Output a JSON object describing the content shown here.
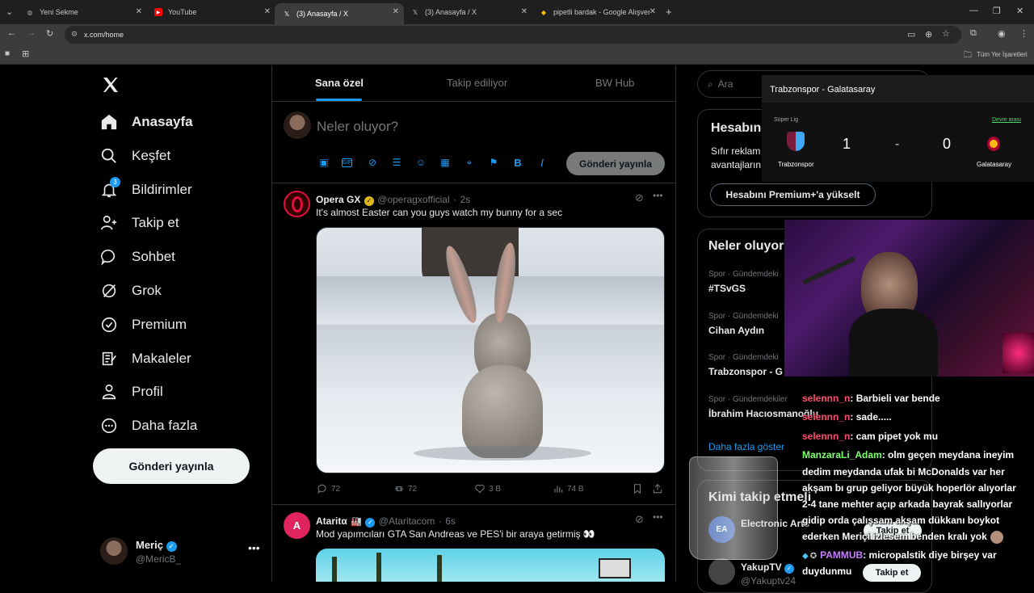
{
  "browser": {
    "tabs": [
      {
        "title": "Yeni Sekme",
        "icon": "globe-icon"
      },
      {
        "title": "YouTube",
        "icon": "youtube-icon"
      },
      {
        "title": "(3) Anasayfa / X",
        "icon": "x-icon"
      },
      {
        "title": "(3) Anasayfa / X",
        "icon": "x-icon"
      },
      {
        "title": "pipetli bardak - Google Alışveri",
        "icon": "google-icon"
      }
    ],
    "url": "x.com/home",
    "bookmarks_all": "Tüm Yer İşaretleri"
  },
  "nav": {
    "items": [
      {
        "label": "Anasayfa",
        "icon": "home-icon"
      },
      {
        "label": "Keşfet",
        "icon": "search-icon"
      },
      {
        "label": "Bildirimler",
        "icon": "bell-icon",
        "badge": "3"
      },
      {
        "label": "Takip et",
        "icon": "follow-icon"
      },
      {
        "label": "Sohbet",
        "icon": "chat-icon"
      },
      {
        "label": "Grok",
        "icon": "grok-icon"
      },
      {
        "label": "Premium",
        "icon": "premium-icon"
      },
      {
        "label": "Makaleler",
        "icon": "articles-icon"
      },
      {
        "label": "Profil",
        "icon": "profile-icon"
      },
      {
        "label": "Daha fazla",
        "icon": "more-icon"
      }
    ],
    "post_button": "Gönderi yayınla",
    "account": {
      "name": "Meriç",
      "handle": "@MericB_"
    }
  },
  "main": {
    "tabs": [
      "Sana özel",
      "Takip ediliyor",
      "BW Hub"
    ],
    "composer_placeholder": "Neler oluyor?",
    "composer_button": "Gönderi yayınla",
    "tweets": [
      {
        "name": "Opera GX",
        "handle": "@operagxofficial",
        "time": "2s",
        "text": "It's almost Easter can you guys watch my bunny for a sec",
        "replies": "72",
        "retweets": "72",
        "likes": "3 B",
        "views": "74 B"
      },
      {
        "name": "Ataritα",
        "handle": "@Ataritacom",
        "time": "6s",
        "text": "Mod yapımcıları GTA San Andreas ve PES'i bir araya getirmiş 👀"
      }
    ]
  },
  "right": {
    "search_placeholder": "Ara",
    "premium": {
      "title": "Hesabın",
      "text_line1": "Sıfır reklam",
      "text_line2": "avantajların",
      "button": "Hesabını Premium+'a yükselt"
    },
    "trends_title": "Neler oluyor",
    "trends": [
      {
        "category": "Spor · Gündemdeki",
        "name": "#TSvGS"
      },
      {
        "category": "Spor · Gündemdeki",
        "name": "Cihan Aydın"
      },
      {
        "category": "Spor · Gündemdeki",
        "name": "Trabzonspor - G"
      },
      {
        "category": "Spor · Gündemdekiler",
        "name": "İbrahim Hacıosmanoğlu"
      }
    ],
    "show_more": "Daha fazla göster",
    "who_to_follow": "Kimi takip etmeli",
    "follow_suggestions": [
      {
        "name": "Electronic Arts",
        "button": "Takip et"
      },
      {
        "name": "YakupTV",
        "handle": "@Yakuptv24",
        "button": "Takip et"
      }
    ]
  },
  "scoreboard": {
    "title": "Trabzonspor - Galatasaray",
    "league": "Süper Lig",
    "status": "Devre arası",
    "home": "Trabzonspor",
    "away": "Galatasaray",
    "home_score": "1",
    "away_score": "0",
    "separator": "-"
  },
  "chat": [
    {
      "user": "selennn_n",
      "msg": ": Barbieli var bende"
    },
    {
      "user": "selennn_n",
      "msg": ": sade....."
    },
    {
      "user": "selennn_n",
      "msg": ": cam pipet yok mu"
    },
    {
      "user": "ManzaraLi_Adam",
      "msg": ": olm geçen meydana ineyim"
    },
    {
      "user": "",
      "msg": "dedim meydanda ufak bi McDonalds var her"
    },
    {
      "user": "",
      "msg": "akşam bı grup geliyor büyük hoperlör alıyorlar"
    },
    {
      "user": "",
      "msg": "2-4 tane mehter açıp arkada bayrak sallıyorlar"
    },
    {
      "user": "",
      "msg": "gidip orda çalışsam akşam dükkanı boykot"
    },
    {
      "user": "",
      "msg": "ederken Meriçi izlesem benden kralı yok"
    },
    {
      "user": "PAMMUB",
      "msg": ": micropalstik diye birşey var"
    },
    {
      "user": "",
      "msg": "duydunmu"
    }
  ]
}
